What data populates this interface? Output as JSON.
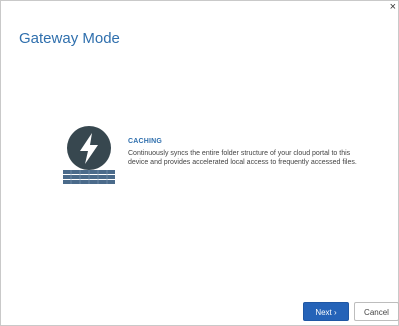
{
  "dialog": {
    "title": "Gateway Mode",
    "close_label": "×"
  },
  "mode": {
    "icon": "lightning-bolt-icon",
    "name": "CACHING",
    "description": "Continuously syncs the entire folder structure of your cloud portal to this device and provides accelerated local access to frequently accessed files."
  },
  "footer": {
    "next_label": "Next ›",
    "cancel_label": "Cancel"
  },
  "colors": {
    "accent": "#2f6fad",
    "primary_button": "#2563b8",
    "icon_dark": "#37474f",
    "icon_storage": "#4a6a8a"
  }
}
